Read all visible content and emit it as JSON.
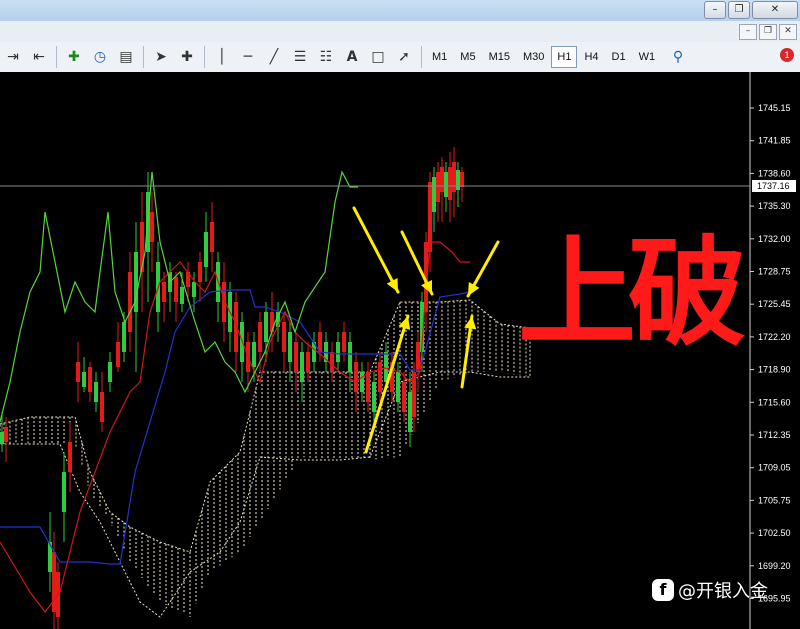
{
  "window": {
    "minimize_icon": "minimize-icon",
    "restore_icon": "restore-icon",
    "close_icon": "close-icon"
  },
  "toolbar": {
    "timeframes": [
      "M1",
      "M5",
      "M15",
      "M30",
      "H1",
      "H4",
      "D1",
      "W1"
    ],
    "active_timeframe": "H1",
    "notification_count": "1"
  },
  "chart": {
    "price_axis": [
      "1745.15",
      "1741.85",
      "1738.60",
      "1735.30",
      "1732.00",
      "1728.75",
      "1725.45",
      "1722.20",
      "1718.90",
      "1715.60",
      "1712.35",
      "1709.05",
      "1705.75",
      "1702.50",
      "1699.20",
      "1695.95"
    ],
    "current_price": "1737.16",
    "annotation_text": "上破",
    "colors": {
      "bull": "#2ecc40",
      "bear": "#e41b1b",
      "tenkan": "#d01818",
      "kijun": "#2233cc",
      "chikou": "#5ad43a",
      "cloud": "#f2e2c4",
      "arrow": "#ffee00",
      "annotation": "#ff1a1a"
    }
  },
  "watermark": {
    "logo": "f",
    "text": "@开银入金"
  }
}
